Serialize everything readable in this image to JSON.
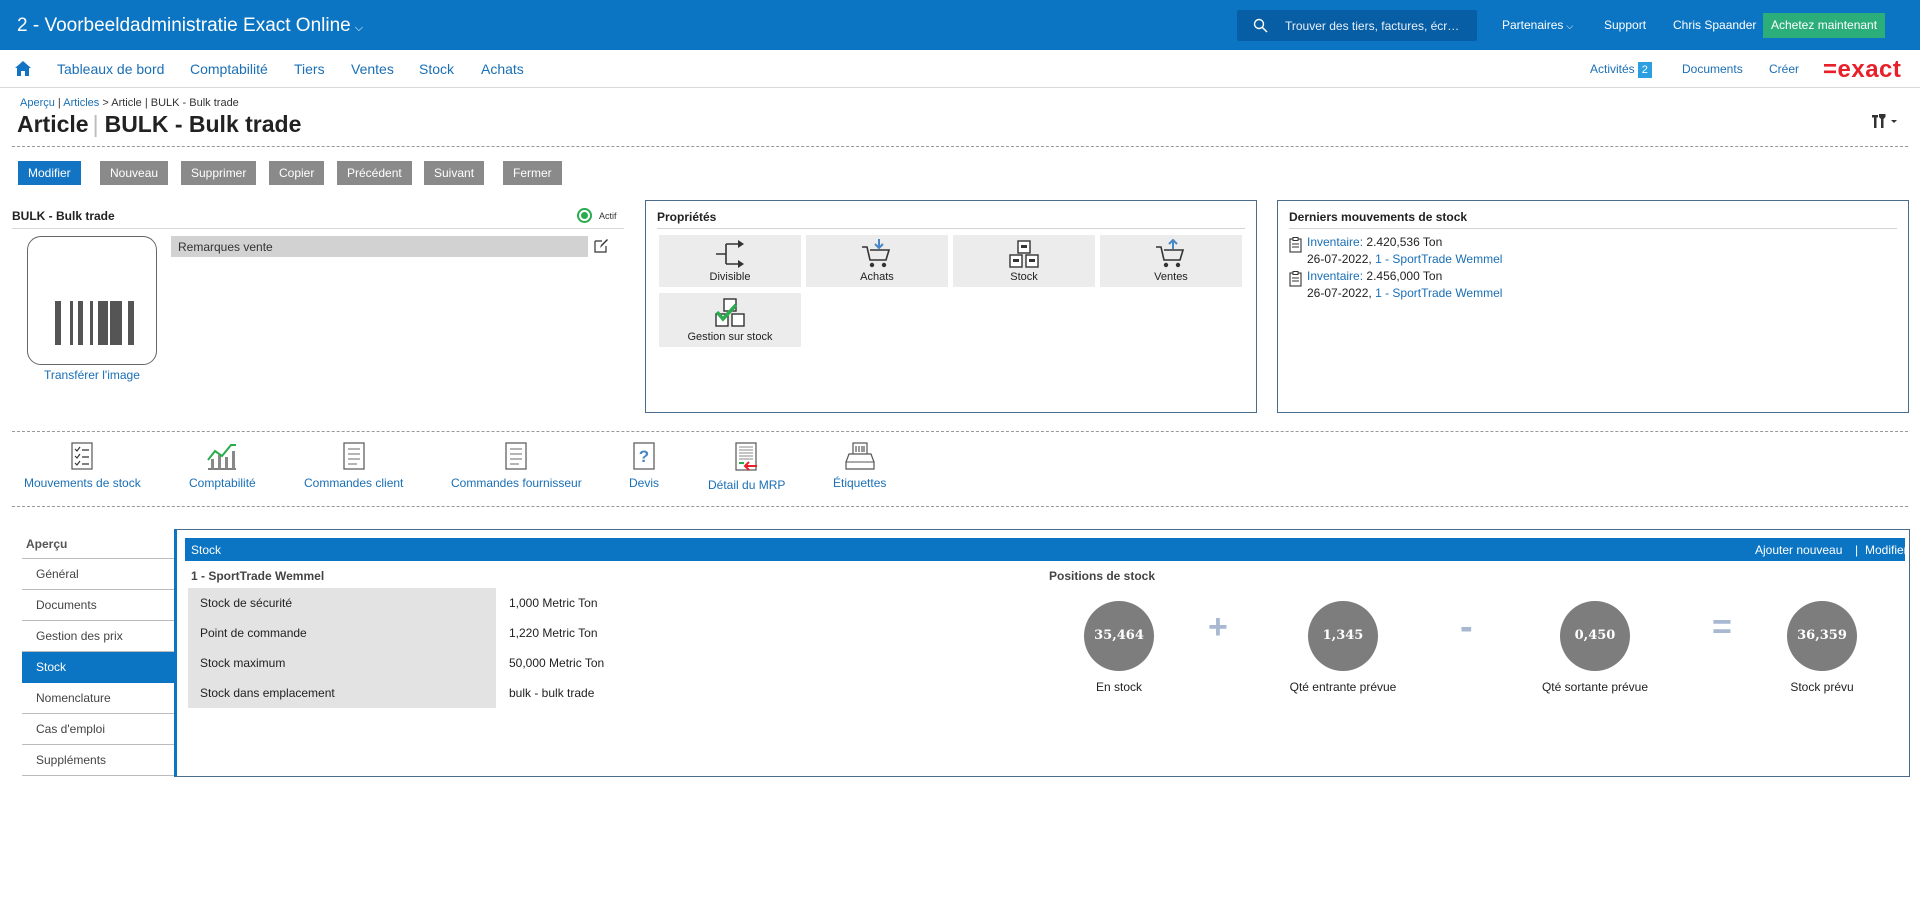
{
  "topbar": {
    "title": "2 - Voorbeeldadministratie Exact Online",
    "search_placeholder": "Trouver des tiers, factures, écr…",
    "partners": "Partenaires",
    "support": "Support",
    "user": "Chris Spaander",
    "buy": "Achetez maintenant",
    "accent": "#0b75c3",
    "buy_color": "#2cae7a"
  },
  "nav": {
    "items": [
      "Tableaux de bord",
      "Comptabilité",
      "Tiers",
      "Ventes",
      "Stock",
      "Achats"
    ],
    "activities": "Activités",
    "activities_count": "2",
    "documents": "Documents",
    "create": "Créer",
    "logo": "=exact",
    "logo_color": "#e8202a"
  },
  "breadcrumb": {
    "overview": "Aperçu",
    "articles": "Articles",
    "rest": "> Article | BULK - Bulk trade"
  },
  "page": {
    "title_prefix": "Article",
    "title_sep": "|",
    "title": "BULK - Bulk trade"
  },
  "actions": [
    "Modifier",
    "Nouveau",
    "Supprimer",
    "Copier",
    "Précédent",
    "Suivant",
    "Fermer"
  ],
  "item": {
    "name": "BULK - Bulk trade",
    "status": "Actif",
    "upload_image": "Transférer l'image",
    "remarks": "Remarques vente"
  },
  "properties": {
    "title": "Propriétés",
    "tiles": [
      "Divisible",
      "Achats",
      "Stock",
      "Ventes",
      "Gestion sur stock"
    ]
  },
  "movements": {
    "title": "Derniers mouvements de stock",
    "items": [
      {
        "type": "Inventaire:",
        "qty": "2.420,536 Ton",
        "date": "26-07-2022,",
        "warehouse": "1 - SportTrade Wemmel"
      },
      {
        "type": "Inventaire:",
        "qty": "2.456,000 Ton",
        "date": "26-07-2022,",
        "warehouse": "1 - SportTrade Wemmel"
      }
    ]
  },
  "quicklinks": [
    "Mouvements de stock",
    "Comptabilité",
    "Commandes client",
    "Commandes fournisseur",
    "Devis",
    "Détail du MRP",
    "Étiquettes"
  ],
  "leftnav": {
    "header": "Aperçu",
    "items": [
      "Général",
      "Documents",
      "Gestion des prix",
      "Stock",
      "Nomenclature",
      "Cas d'emploi",
      "Suppléments"
    ],
    "active": "Stock"
  },
  "stock": {
    "header": "Stock",
    "add_new": "Ajouter nouveau",
    "sep": "|",
    "edit": "Modifier",
    "warehouse": "1 - SportTrade Wemmel",
    "fields": [
      {
        "label": "Stock de sécurité",
        "value": "1,000 Metric Ton"
      },
      {
        "label": "Point de commande",
        "value": "1,220 Metric Ton"
      },
      {
        "label": "Stock maximum",
        "value": "50,000 Metric Ton"
      },
      {
        "label": "Stock dans emplacement",
        "value": "bulk - bulk trade"
      }
    ],
    "positions_title": "Positions de stock",
    "positions": [
      {
        "value": "35,464",
        "label": "En stock"
      },
      {
        "value": "1,345",
        "label": "Qté entrante prévue"
      },
      {
        "value": "0,450",
        "label": "Qté sortante prévue"
      },
      {
        "value": "36,359",
        "label": "Stock prévu"
      }
    ],
    "operators": [
      "+",
      "-",
      "="
    ]
  }
}
